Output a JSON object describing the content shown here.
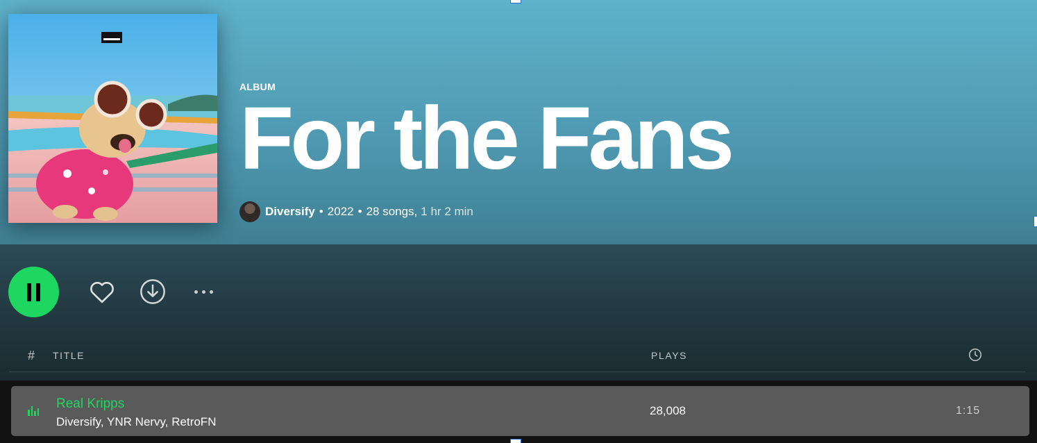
{
  "album": {
    "type_label": "ALBUM",
    "title": "For the Fans",
    "artist": "Diversify",
    "separator": "•",
    "year": "2022",
    "songs": "28 songs,",
    "duration": "1 hr 2 min"
  },
  "controls": {
    "play_icon": "pause-icon",
    "like_icon": "heart-icon",
    "download_icon": "download-icon",
    "more_icon": "more-icon"
  },
  "columns": {
    "number": "#",
    "title": "TITLE",
    "plays": "PLAYS",
    "duration_icon": "clock-icon"
  },
  "tracks": [
    {
      "title": "Real Kripps",
      "artists": "Diversify, YNR Nervy, RetroFN",
      "plays": "28,008",
      "duration": "1:15",
      "playing": true
    }
  ],
  "colors": {
    "accent": "#1ed760",
    "header_top": "#5fb2cb",
    "row_highlight": "#5a5a5a"
  }
}
